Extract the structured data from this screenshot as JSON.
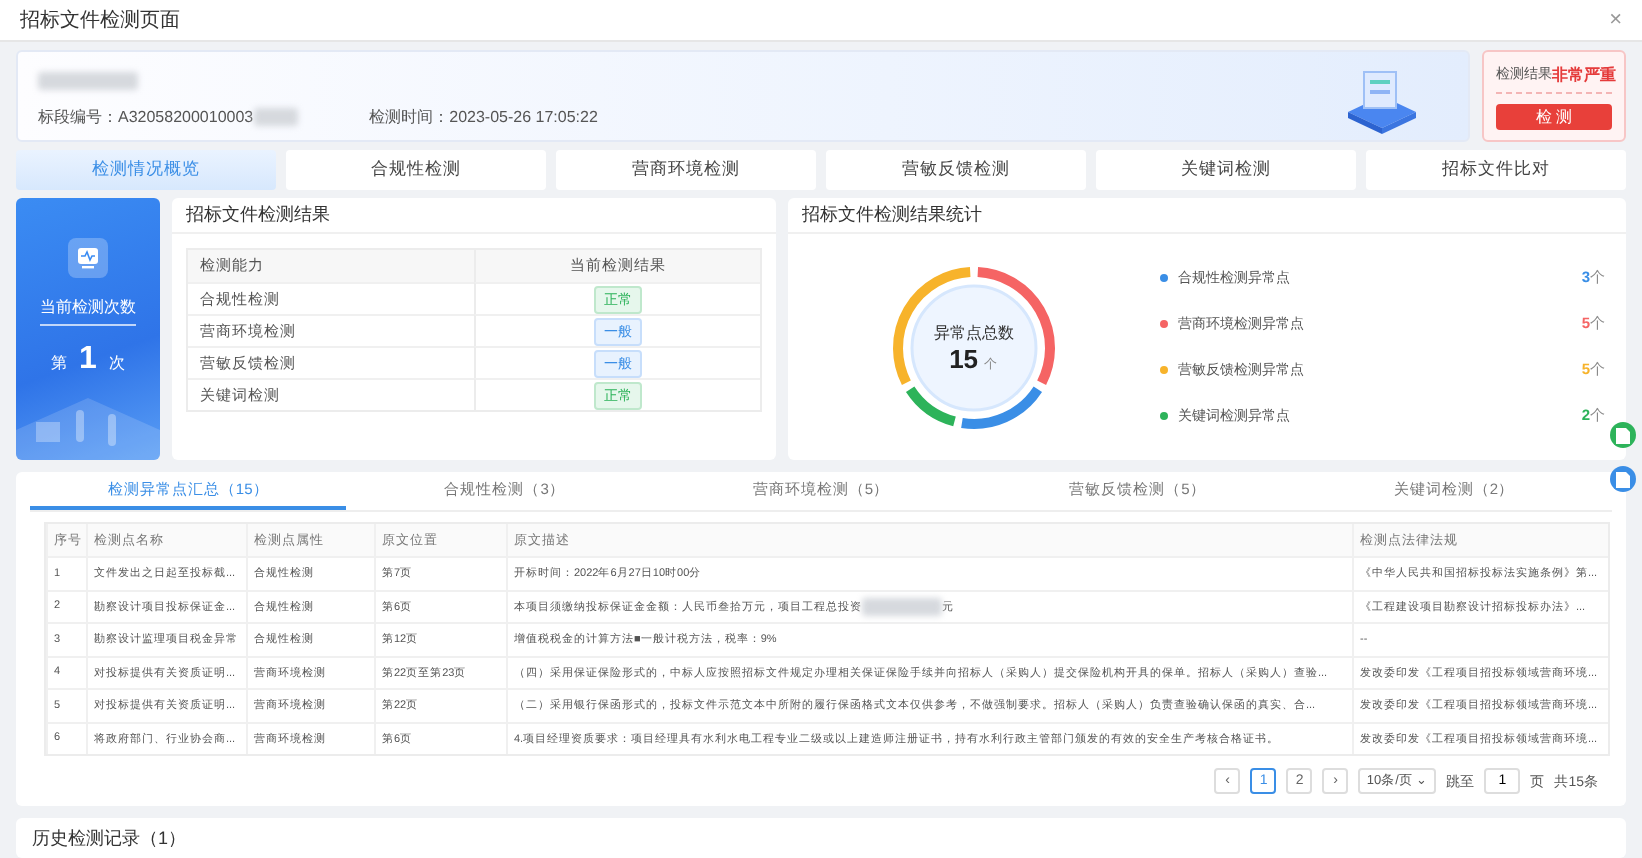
{
  "window": {
    "title": "招标文件检测页面",
    "close": "×"
  },
  "header": {
    "bid_label": "标段编号：",
    "bid_value": "A32058200010003",
    "time": "检测时间：2023-05-26 17:05:22",
    "result_label": "检测结果",
    "result_value": "非常严重",
    "button": "检 测"
  },
  "tabs": [
    {
      "label": "检测情况概览",
      "selected": true
    },
    {
      "label": "合规性检测",
      "selected": false
    },
    {
      "label": "营商环境检测",
      "selected": false
    },
    {
      "label": "营敏反馈检测",
      "selected": false
    },
    {
      "label": "关键词检测",
      "selected": false
    },
    {
      "label": "招标文件比对",
      "selected": false
    }
  ],
  "count_card": {
    "title": "当前检测次数",
    "prefix": "第",
    "count": "1",
    "suffix": "次"
  },
  "result_panel": {
    "title": "招标文件检测结果",
    "columns": [
      "检测能力",
      "当前检测结果"
    ],
    "rows": [
      {
        "name": "合规性检测",
        "result": "正常",
        "kind": "normal"
      },
      {
        "name": "营商环境检测",
        "result": "一般",
        "kind": "general"
      },
      {
        "name": "营敏反馈检测",
        "result": "一般",
        "kind": "general"
      },
      {
        "name": "关键词检测",
        "result": "正常",
        "kind": "normal"
      }
    ]
  },
  "stats_panel": {
    "title": "招标文件检测结果统计",
    "total_label": "异常点总数",
    "total": "15",
    "total_unit": "个",
    "legend": [
      {
        "label": "合规性检测异常点",
        "count": "3",
        "unit": "个",
        "color": "#3a8ee6"
      },
      {
        "label": "营商环境检测异常点",
        "count": "5",
        "unit": "个",
        "color": "#f56464"
      },
      {
        "label": "营敏反馈检测异常点",
        "count": "5",
        "unit": "个",
        "color": "#f7b32b"
      },
      {
        "label": "关键词检测异常点",
        "count": "2",
        "unit": "个",
        "color": "#2db35a"
      }
    ]
  },
  "detail_tabs": [
    {
      "label": "检测异常点汇总（15）",
      "selected": true
    },
    {
      "label": "合规性检测（3）",
      "selected": false
    },
    {
      "label": "营商环境检测（5）",
      "selected": false
    },
    {
      "label": "营敏反馈检测（5）",
      "selected": false
    },
    {
      "label": "关键词检测（2）",
      "selected": false
    }
  ],
  "table": {
    "columns": [
      "序号",
      "检测点名称",
      "检测点属性",
      "原文位置",
      "原文描述",
      "检测点法律法规"
    ],
    "rows": [
      {
        "no": "1",
        "name": "文件发出之日起至投标截...",
        "type": "合规性检测",
        "position": "第7页",
        "description": "开标时间：2022年6月27日10时00分",
        "law": "《中华人民共和国招标投标法实施条例》第..."
      },
      {
        "no": "2",
        "name": "勘察设计项目投标保证金...",
        "type": "合规性检测",
        "position": "第6页",
        "description": "本项目须缴纳投标保证金金额：人民币叁拾万元，项目工程总投资",
        "redacted_suffix": "元",
        "law": "《工程建设项目勘察设计招标投标办法》..."
      },
      {
        "no": "3",
        "name": "勘察设计监理项目税金异常",
        "type": "合规性检测",
        "position": "第12页",
        "description": "增值税税金的计算方法■一般计税方法，税率：9%",
        "law": "--"
      },
      {
        "no": "4",
        "name": "对投标提供有关资质证明...",
        "type": "营商环境检测",
        "position": "第22页至第23页",
        "description": "（四）采用保证保险形式的，中标人应按照招标文件规定办理相关保证保险手续并向招标人（采购人）提交保险机构开具的保单。招标人（采购人）查验...",
        "law": "发改委印发《工程项目招投标领域营商环境..."
      },
      {
        "no": "5",
        "name": "对投标提供有关资质证明...",
        "type": "营商环境检测",
        "position": "第22页",
        "description": "（二）采用银行保函形式的，投标文件示范文本中所附的履行保函格式文本仅供参考，不做强制要求。招标人（采购人）负责查验确认保函的真实、合...",
        "law": "发改委印发《工程项目招投标领域营商环境..."
      },
      {
        "no": "6",
        "name": "将政府部门、行业协会商...",
        "type": "营商环境检测",
        "position": "第6页",
        "description": "4.项目经理资质要求：项目经理具有水利水电工程专业二级或以上建造师注册证书，持有水利行政主管部门颁发的有效的安全生产考核合格证书。",
        "law": "发改委印发《工程项目招投标领域营商环境..."
      }
    ]
  },
  "pagination": {
    "prev": "‹",
    "pages": [
      {
        "label": "1",
        "selected": true
      },
      {
        "label": "2",
        "selected": false
      }
    ],
    "next": "›",
    "page_size": "10条/页",
    "page_size_caret": "⌄",
    "jump_label": "跳至",
    "jump_value": "1",
    "jump_unit": "页",
    "total": "共15条"
  },
  "history": {
    "title": "历史检测记录（1）"
  }
}
